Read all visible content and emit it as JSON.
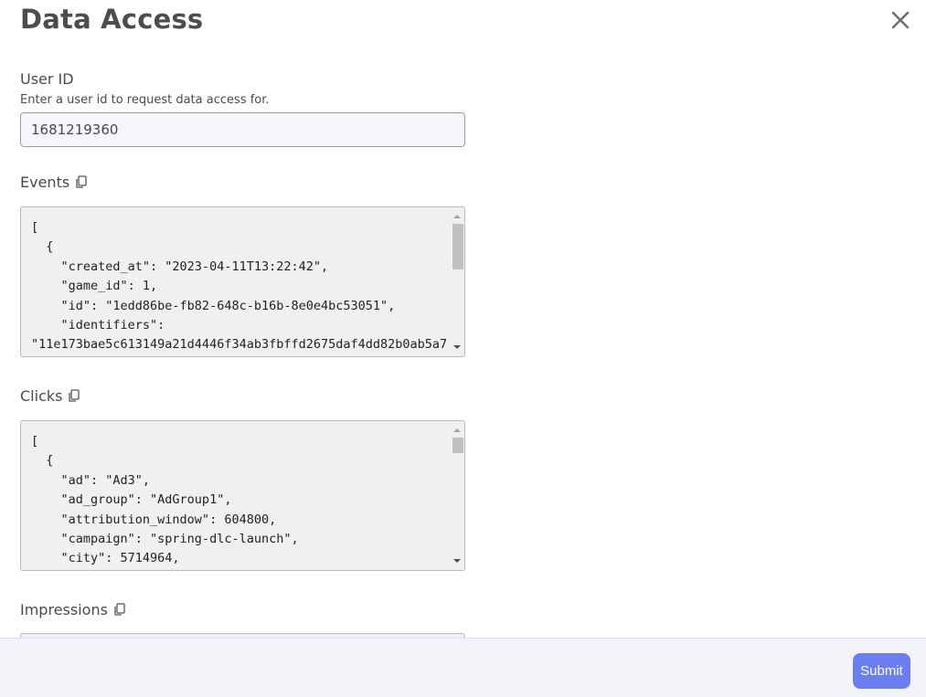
{
  "modal": {
    "title": "Data Access"
  },
  "user_id": {
    "label": "User ID",
    "help": "Enter a user id to request data access for.",
    "value": "1681219360"
  },
  "events": {
    "label": "Events",
    "content": "[\n  {\n    \"created_at\": \"2023-04-11T13:22:42\",\n    \"game_id\": 1,\n    \"id\": \"1edd86be-fb82-648c-b16b-8e0e4bc53051\",\n    \"identifiers\":\n\"11e173bae5c613149a21d4446f34ab3fbffd2675daf4dd82b0ab5a7"
  },
  "clicks": {
    "label": "Clicks",
    "content": "[\n  {\n    \"ad\": \"Ad3\",\n    \"ad_group\": \"AdGroup1\",\n    \"attribution_window\": 604800,\n    \"campaign\": \"spring-dlc-launch\",\n    \"city\": 5714964,"
  },
  "impressions": {
    "label": "Impressions"
  },
  "footer": {
    "submit_label": "Submit"
  },
  "icons": {
    "close": "close-icon",
    "copy": "copy-icon",
    "scroll_up": "scroll-up-arrow-icon",
    "scroll_down": "scroll-down-arrow-icon"
  },
  "colors": {
    "accent": "#6a7ef0",
    "footer_bg": "#f2f4fa",
    "input_bg": "#f4f6fb",
    "code_bg": "#f0f0f0"
  }
}
